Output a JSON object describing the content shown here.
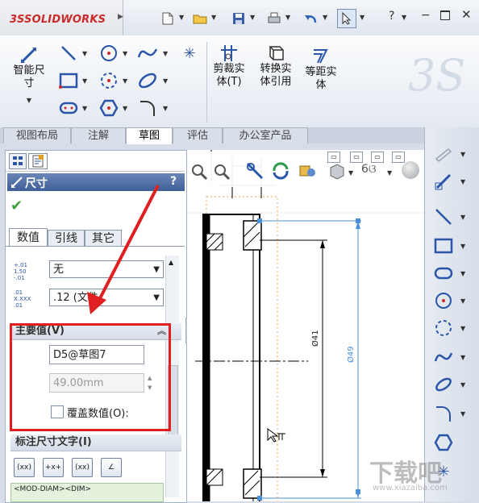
{
  "brand": {
    "logo_ds": "3S",
    "logo_text": "SOLIDWORKS"
  },
  "window": {
    "help": "?"
  },
  "ribbon": {
    "smart_dim": "智能尺\n寸",
    "trim": "剪裁实\n体(T)",
    "convert": "转换实\n体引用",
    "offset": "等距实\n体"
  },
  "tabs": [
    "视图布局",
    "注解",
    "草图",
    "评估",
    "办公室产品"
  ],
  "selected_tab": "草图",
  "pm": {
    "title": "尺寸",
    "help": "?",
    "subtabs": [
      "数值",
      "引线",
      "其它"
    ],
    "tolerance_value": "无",
    "precision_value": ".12 (文件",
    "primary_group_title": "主要值(V)",
    "name_value": "D5@草图7",
    "dim_value": "49.00mm",
    "override_label": "覆盖数值(O):",
    "dim_text_title": "标注尺寸文字(I)",
    "dim_text_buttons": [
      "(xx)",
      "+x+",
      "(xx)",
      "∠"
    ],
    "dim_text_value": "<MOD-DIAM><DIM>"
  },
  "drawing": {
    "dim_41": "Ø41",
    "dim_49": "Ø49"
  },
  "watermark": {
    "text": "下载吧",
    "site": "www.xiazaiba.com"
  },
  "colors": {
    "accent_red": "#e02020",
    "selection_blue": "#4a90d9"
  }
}
